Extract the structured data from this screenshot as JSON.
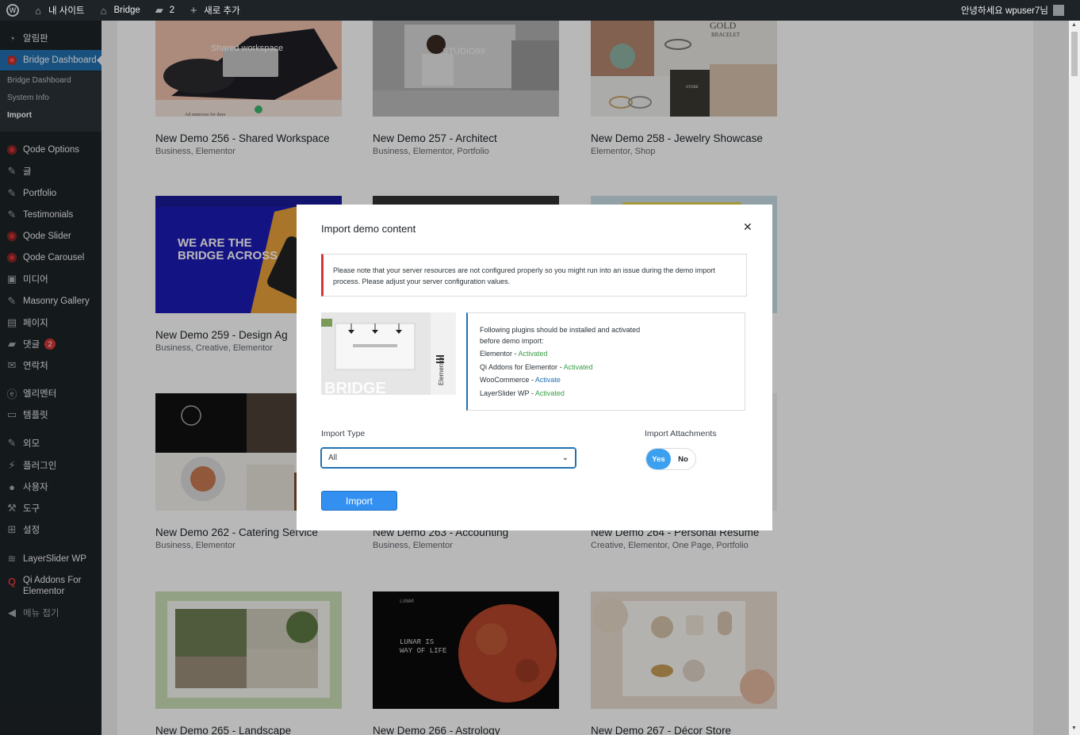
{
  "adminbar": {
    "site_name": "내 사이트",
    "theme_name": "Bridge",
    "comments_count": "2",
    "new_label": "새로 추가",
    "greeting": "안녕하세요 wpuser7님"
  },
  "sidebar": {
    "dashboard": "알림판",
    "bridge_dashboard": "Bridge Dashboard",
    "submenu": [
      "Bridge Dashboard",
      "System Info",
      "Import"
    ],
    "items": [
      "Qode Options",
      "글",
      "Portfolio",
      "Testimonials",
      "Qode Slider",
      "Qode Carousel",
      "미디어",
      "Masonry Gallery",
      "페이지",
      "댓글",
      "연락처",
      "엘리멘터",
      "템플릿",
      "외모",
      "플러그인",
      "사용자",
      "도구",
      "설정",
      "LayerSlider WP",
      "Qi Addons For Elementor",
      "메뉴 접기"
    ],
    "comments_badge": "2"
  },
  "demos": [
    {
      "title": "New Demo 256 - Shared Workspace",
      "tags": "Business,  Elementor",
      "thumb_text": "Shared workspace"
    },
    {
      "title": "New Demo 257 - Architect",
      "tags": "Business,  Elementor,  Portfolio",
      "thumb_text": "STUDIO99"
    },
    {
      "title": "New Demo 258 - Jewelry Showcase",
      "tags": "Elementor,  Shop",
      "thumb_text": "GOLD",
      "thumb_sub": "BRACELET",
      "thumb_store": "STORE"
    },
    {
      "title": "New Demo 259 - Design Ag",
      "tags": "Business,  Creative,  Elementor",
      "thumb_text": "WE ARE THE",
      "thumb_sub": "BRIDGE ACROSS"
    },
    {
      "title": "New Demo 262 - Catering Service",
      "tags": "Business,  Elementor"
    },
    {
      "title": "New Demo 263 - Accounting",
      "tags": "Business,  Elementor"
    },
    {
      "title": "New Demo 264 - Personal Resume",
      "tags": "Creative,  Elementor,  One Page,  Portfolio"
    },
    {
      "title": "New Demo 265 - Landscape",
      "tags": ""
    },
    {
      "title": "New Demo 266 - Astrology",
      "tags": "",
      "thumb_text": "LUNAR",
      "thumb_sub": "LUNAR IS",
      "thumb_sub2": "WAY OF LIFE"
    },
    {
      "title": "New Demo 267 - Décor Store",
      "tags": ""
    }
  ],
  "modal": {
    "title": "Import demo content",
    "notice": "Please note that your server resources are not configured properly so you might run into an issue during the demo import process. Please adjust your server configuration values.",
    "plugins_intro_1": "Following plugins should be installed and activated",
    "plugins_intro_2": "before demo import:",
    "plugins": [
      {
        "name": "Elementor",
        "status": "Activated",
        "status_color": "#3a9e47"
      },
      {
        "name": "Qi Addons for Elementor",
        "status": "Activated",
        "status_color": "#3a9e47"
      },
      {
        "name": "WooCommerce",
        "status": "Activate",
        "status_color": "#2271b1"
      },
      {
        "name": "LayerSlider WP",
        "status": "Activated",
        "status_color": "#3a9e47"
      }
    ],
    "import_type_label": "Import Type",
    "import_type_value": "All",
    "attachments_label": "Import Attachments",
    "yes": "Yes",
    "no": "No",
    "import_button": "Import",
    "preview_text": "BRIDGE",
    "preview_side": "Elementor"
  },
  "colors": {
    "admin_dark": "#1d2327",
    "accent_blue": "#2271b1",
    "error_red": "#d63638",
    "success_green": "#3a9e47",
    "toggle_blue": "#3aa0ef"
  }
}
